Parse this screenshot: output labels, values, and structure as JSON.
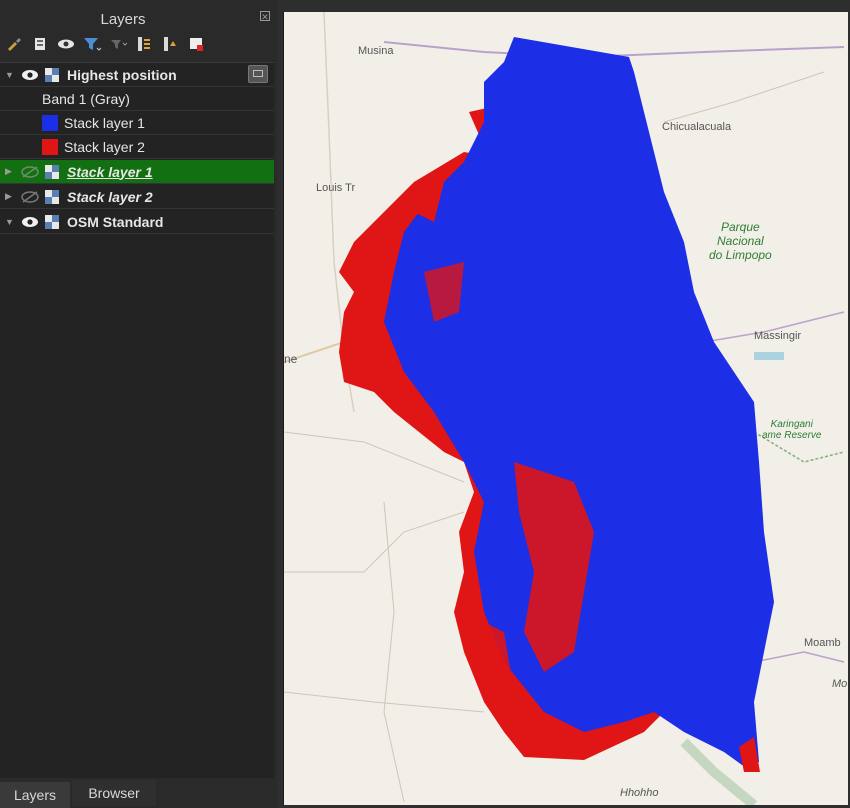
{
  "panel": {
    "title": "Layers",
    "tools": [
      "style-icon",
      "add-group-icon",
      "visibility-icon",
      "filter-icon",
      "filter-legend-icon",
      "expand-all-icon",
      "collapse-all-icon",
      "remove-layer-icon"
    ]
  },
  "layers": [
    {
      "name": "Highest position",
      "visible": true,
      "expanded": true
    },
    {
      "name": "Band 1 (Gray)"
    },
    {
      "name": "Stack layer 1",
      "color": "#1c2ee6"
    },
    {
      "name": "Stack layer 2",
      "color": "#e01515"
    },
    {
      "name": "Stack layer 1",
      "visible": false,
      "selected": true
    },
    {
      "name": "Stack layer 2",
      "visible": false
    },
    {
      "name": "OSM Standard",
      "visible": true,
      "expanded": true
    }
  ],
  "tabs": [
    "Layers",
    "Browser"
  ],
  "map": {
    "places": [
      "Musina",
      "Chicualacuala",
      "Louis Tr",
      "ne",
      "Massingir",
      "Moamb",
      "Mo",
      "Hhohho"
    ],
    "park1": [
      "Parque",
      "Nacional",
      "do Limpopo"
    ],
    "park2": [
      "Karingani",
      "ame Reserve"
    ],
    "colors": {
      "blue": "#1c2ee6",
      "red": "#e01515",
      "background": "#f2efe9"
    }
  }
}
